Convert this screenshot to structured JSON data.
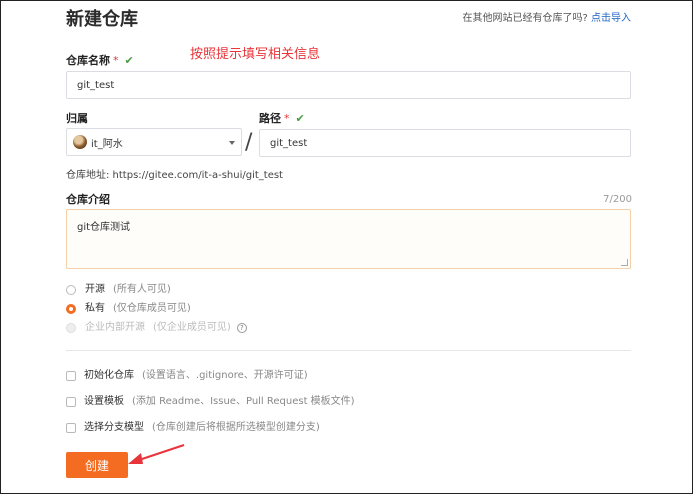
{
  "page": {
    "title": "新建仓库",
    "import_prompt": "在其他网站已经有仓库了吗?",
    "import_link": "点击导入",
    "annotation": "按照提示填写相关信息"
  },
  "form": {
    "repo_name": {
      "label": "仓库名称",
      "required": "*",
      "value": "git_test"
    },
    "owner": {
      "label": "归属",
      "value": "it_阿水"
    },
    "separator": "/",
    "path": {
      "label": "路径",
      "required": "*",
      "value": "git_test"
    },
    "address": "仓库地址: https://gitee.com/it-a-shui/git_test",
    "description": {
      "label": "仓库介绍",
      "counter": "7/200",
      "value": "git仓库测试"
    },
    "visibility": [
      {
        "label": "开源",
        "note": "(所有人可见)",
        "state": "unchecked"
      },
      {
        "label": "私有",
        "note": "(仅仓库成员可见)",
        "state": "checked"
      },
      {
        "label": "企业内部开源",
        "note": "(仅企业成员可见)",
        "state": "disabled"
      }
    ],
    "help_glyph": "?",
    "options": [
      {
        "label": "初始化仓库",
        "note": "(设置语言、.gitignore、开源许可证)"
      },
      {
        "label": "设置模板",
        "note": "(添加 Readme、Issue、Pull Request 模板文件)"
      },
      {
        "label": "选择分支模型",
        "note": "(仓库创建后将根据所选模型创建分支)"
      }
    ],
    "submit_label": "创建"
  },
  "icons": {
    "check": "✔",
    "valid_check_color": "#4a9d3e",
    "accent": "#f36c21",
    "annotation_color": "#e8343a",
    "link_color": "#1e63c4"
  }
}
